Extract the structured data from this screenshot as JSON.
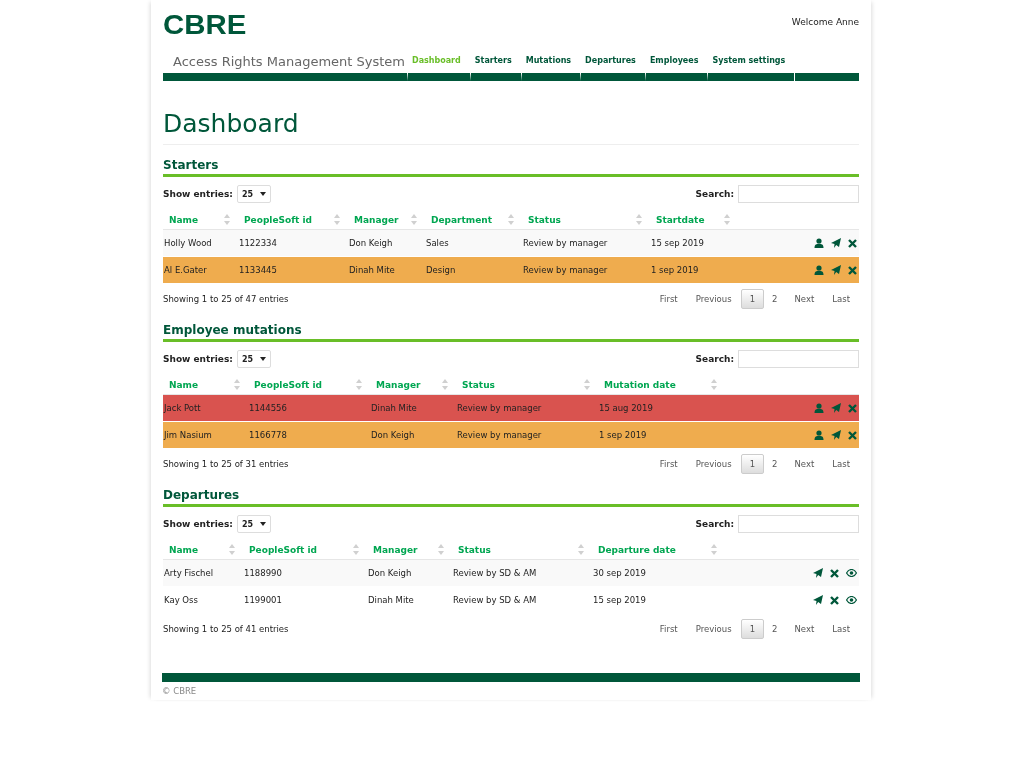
{
  "header": {
    "logo": "CBRE",
    "welcome": "Welcome Anne",
    "system_title": "Access Rights Management System"
  },
  "nav": [
    {
      "label": "Dashboard",
      "selected": true
    },
    {
      "label": "Starters",
      "selected": false
    },
    {
      "label": "Mutations",
      "selected": false
    },
    {
      "label": "Departures",
      "selected": false
    },
    {
      "label": "Employees",
      "selected": false
    },
    {
      "label": "System settings",
      "selected": false
    }
  ],
  "page_title": "Dashboard",
  "sections": [
    {
      "title": "Starters",
      "show_entries_label": "Show entries:",
      "entries": "25",
      "search_label": "Search:",
      "columns": [
        "Name",
        "PeopleSoft id",
        "Manager",
        "Department",
        "Status",
        "Startdate"
      ],
      "rows": [
        {
          "color": "#f9f9f9",
          "cells": [
            "Holly Wood",
            "1122334",
            "Don Keigh",
            "Sales",
            "Review by manager",
            "15 sep 2019"
          ],
          "actions": [
            {
              "kind": "person"
            },
            {
              "kind": "send"
            },
            {
              "kind": "delete"
            }
          ]
        },
        {
          "color": "#efac4e",
          "cells": [
            "Al E.Gater",
            "1133445",
            "Dinah Mite",
            "Design",
            "Review by manager",
            "1 sep 2019"
          ],
          "actions": [
            {
              "kind": "person"
            },
            {
              "kind": "send"
            },
            {
              "kind": "delete"
            }
          ]
        }
      ],
      "info": "Showing 1 to 25 of 47 entries",
      "pager": {
        "first": "First",
        "previous": "Previous",
        "pages": [
          {
            "label": "1",
            "selected": true
          },
          {
            "label": "2",
            "selected": false
          }
        ],
        "next": "Next",
        "last": "Last"
      }
    },
    {
      "title": "Employee mutations",
      "show_entries_label": "Show entries:",
      "entries": "25",
      "search_label": "Search:",
      "columns": [
        "Name",
        "PeopleSoft id",
        "Manager",
        "Status",
        "Mutation date"
      ],
      "rows": [
        {
          "color": "#d9534f",
          "cells": [
            "Jack Pott",
            "1144556",
            "Dinah Mite",
            "Review by manager",
            "15 aug 2019"
          ],
          "actions": [
            {
              "kind": "person"
            },
            {
              "kind": "send"
            },
            {
              "kind": "delete"
            }
          ]
        },
        {
          "color": "#efac4e",
          "cells": [
            "Jim Nasium",
            "1166778",
            "Don Keigh",
            "Review by manager",
            "1 sep 2019"
          ],
          "actions": [
            {
              "kind": "person"
            },
            {
              "kind": "send"
            },
            {
              "kind": "delete"
            }
          ]
        }
      ],
      "info": "Showing 1 to 25 of 31 entries",
      "pager": {
        "first": "First",
        "previous": "Previous",
        "pages": [
          {
            "label": "1",
            "selected": true
          },
          {
            "label": "2",
            "selected": false
          }
        ],
        "next": "Next",
        "last": "Last"
      }
    },
    {
      "title": "Departures",
      "show_entries_label": "Show entries:",
      "entries": "25",
      "search_label": "Search:",
      "columns": [
        "Name",
        "PeopleSoft id",
        "Manager",
        "Status",
        "Departure date"
      ],
      "rows": [
        {
          "color": "#f9f9f9",
          "cells": [
            "Arty Fischel",
            "1188990",
            "Don Keigh",
            "Review by SD & AM",
            "30 sep 2019"
          ],
          "actions": [
            {
              "kind": "send"
            },
            {
              "kind": "delete"
            },
            {
              "kind": "view"
            }
          ]
        },
        {
          "color": "#ffffff",
          "cells": [
            "Kay Oss",
            "1199001",
            "Dinah Mite",
            "Review by SD & AM",
            "15 sep 2019"
          ],
          "actions": [
            {
              "kind": "send"
            },
            {
              "kind": "delete"
            },
            {
              "kind": "view"
            }
          ]
        }
      ],
      "info": "Showing 1 to 25 of 41 entries",
      "pager": {
        "first": "First",
        "previous": "Previous",
        "pages": [
          {
            "label": "1",
            "selected": true
          },
          {
            "label": "2",
            "selected": false
          }
        ],
        "next": "Next",
        "last": "Last"
      }
    }
  ],
  "footer": {
    "copyright": "© CBRE"
  }
}
